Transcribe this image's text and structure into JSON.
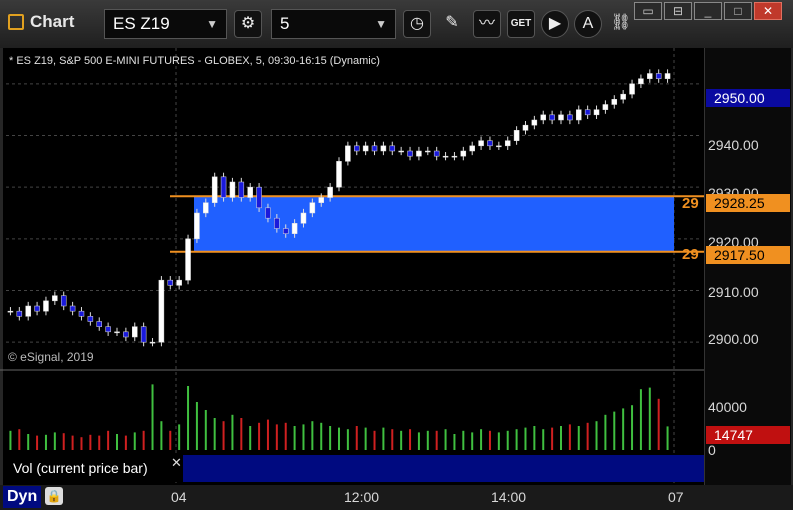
{
  "window": {
    "title": "Chart"
  },
  "toolbar": {
    "symbol": "ES Z19",
    "interval": "5"
  },
  "chart": {
    "header": "* ES Z19, S&P 500 E-MINI FUTURES - GLOBEX, 5, 09:30-16:15 (Dynamic)",
    "copyright": "© eSignal, 2019",
    "current_price": "2950.00",
    "level_high": "2928.25",
    "level_low": "2917.50",
    "level_prefix": "29",
    "y_ticks": [
      "2940.00",
      "2930.00",
      "2920.00",
      "2910.00",
      "2900.00"
    ],
    "vol_ticks": [
      "40000",
      "0"
    ],
    "vol_current": "14747",
    "vol_label": "Vol (current price bar)",
    "x_ticks": [
      "04",
      "12:00",
      "14:00",
      "07"
    ],
    "mode": "Dyn"
  },
  "chart_data": {
    "type": "candlestick",
    "symbol": "ES Z19",
    "ylim": [
      2895,
      2955
    ],
    "zone": {
      "high": 2928.25,
      "low": 2917.5
    },
    "close_series": [
      2906,
      2905,
      2907,
      2906,
      2908,
      2909,
      2907,
      2906,
      2905,
      2904,
      2903,
      2902,
      2902,
      2901,
      2903,
      2900,
      2900,
      2912,
      2911,
      2912,
      2920,
      2925,
      2927,
      2932,
      2928,
      2931,
      2928,
      2930,
      2926,
      2924,
      2922,
      2921,
      2923,
      2925,
      2927,
      2928,
      2930,
      2935,
      2938,
      2937,
      2938,
      2937,
      2938,
      2937,
      2937,
      2936,
      2937,
      2937,
      2936,
      2936,
      2936,
      2937,
      2938,
      2939,
      2938,
      2938,
      2939,
      2941,
      2942,
      2943,
      2944,
      2943,
      2944,
      2943,
      2945,
      2944,
      2945,
      2946,
      2947,
      2948,
      2950,
      2951,
      2952,
      2951,
      2952
    ],
    "volume": [
      12000,
      13000,
      10000,
      9000,
      9500,
      11000,
      10500,
      9000,
      8000,
      9500,
      9000,
      12000,
      10000,
      9000,
      11000,
      12000,
      41000,
      18000,
      12000,
      16000,
      40000,
      30000,
      25000,
      20000,
      18000,
      22000,
      20000,
      15000,
      17000,
      19000,
      16000,
      17000,
      15000,
      16000,
      18000,
      17000,
      15000,
      14000,
      13000,
      15000,
      14000,
      12000,
      14000,
      13000,
      12000,
      13000,
      11000,
      12000,
      12000,
      13000,
      10000,
      12000,
      11000,
      13000,
      12000,
      11000,
      12000,
      13000,
      14000,
      15000,
      13000,
      14000,
      15000,
      16000,
      15000,
      17000,
      18000,
      22000,
      24000,
      26000,
      28000,
      38000,
      39000,
      32000,
      14747
    ]
  }
}
